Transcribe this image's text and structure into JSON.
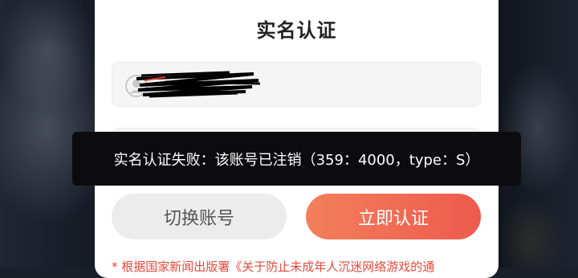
{
  "dialog": {
    "title": "实名认证",
    "account_field": {
      "value": ""
    },
    "second_field": {
      "value": ""
    },
    "switch_button_label": "切换账号",
    "verify_button_label": "立即认证",
    "notice": "* 根据国家新闻出版署《关于防止未成年人沉迷网络游戏的通"
  },
  "toast": {
    "message": "实名认证失败：该账号已注销（359：4000，type：S）"
  },
  "colors": {
    "accent": "#ee5a4d",
    "notice": "#e64a3c"
  },
  "icons": {
    "account": "user-circle-icon"
  }
}
